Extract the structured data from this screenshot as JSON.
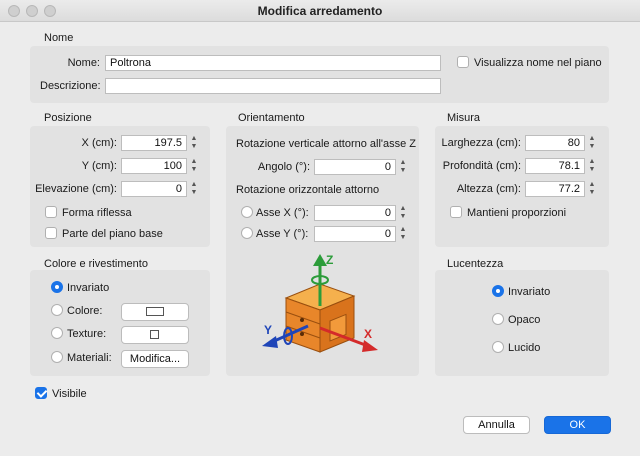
{
  "window": {
    "title": "Modifica arredamento"
  },
  "nome": {
    "section_label": "Nome",
    "name_label": "Nome:",
    "name_value": "Poltrona",
    "description_label": "Descrizione:",
    "description_value": "",
    "show_name_label": "Visualizza nome nel piano"
  },
  "posizione": {
    "section_label": "Posizione",
    "x_label": "X (cm):",
    "x_value": "197.5",
    "y_label": "Y (cm):",
    "y_value": "100",
    "elev_label": "Elevazione (cm):",
    "elev_value": "0",
    "mirrored_label": "Forma riflessa",
    "base_plan_label": "Parte del piano base"
  },
  "orientamento": {
    "section_label": "Orientamento",
    "vertical_rotation_label": "Rotazione verticale attorno all'asse Z",
    "angle_label": "Angolo (°):",
    "angle_value": "0",
    "horizontal_rotation_label": "Rotazione orizzontale attorno",
    "axis_x_label": "Asse X (°):",
    "axis_x_value": "0",
    "axis_y_label": "Asse Y (°):",
    "axis_y_value": "0"
  },
  "misura": {
    "section_label": "Misura",
    "width_label": "Larghezza (cm):",
    "width_value": "80",
    "depth_label": "Profondità (cm):",
    "depth_value": "78.1",
    "height_label": "Altezza (cm):",
    "height_value": "77.2",
    "keep_proportions_label": "Mantieni proporzioni"
  },
  "colore": {
    "section_label": "Colore e rivestimento",
    "unchanged_label": "Invariato",
    "color_label": "Colore:",
    "texture_label": "Texture:",
    "materials_label": "Materiali:",
    "modify_button": "Modifica..."
  },
  "lucentezza": {
    "section_label": "Lucentezza",
    "unchanged_label": "Invariato",
    "matt_label": "Opaco",
    "shiny_label": "Lucido"
  },
  "visible_label": "Visibile",
  "buttons": {
    "cancel": "Annulla",
    "ok": "OK"
  },
  "axes": {
    "z": "Z",
    "x": "X",
    "y": "Y"
  },
  "colors": {
    "accent": "#1a73e8",
    "axis_x": "#d42a2a",
    "axis_y": "#1f45b8",
    "axis_z": "#2c9c3a",
    "cabinet": "#e8862a"
  },
  "state": {
    "show_name": false,
    "mirrored": false,
    "base_plan": false,
    "keep_proportions": false,
    "visible": true,
    "color_mode": "Invariato",
    "shininess": "Invariato"
  }
}
